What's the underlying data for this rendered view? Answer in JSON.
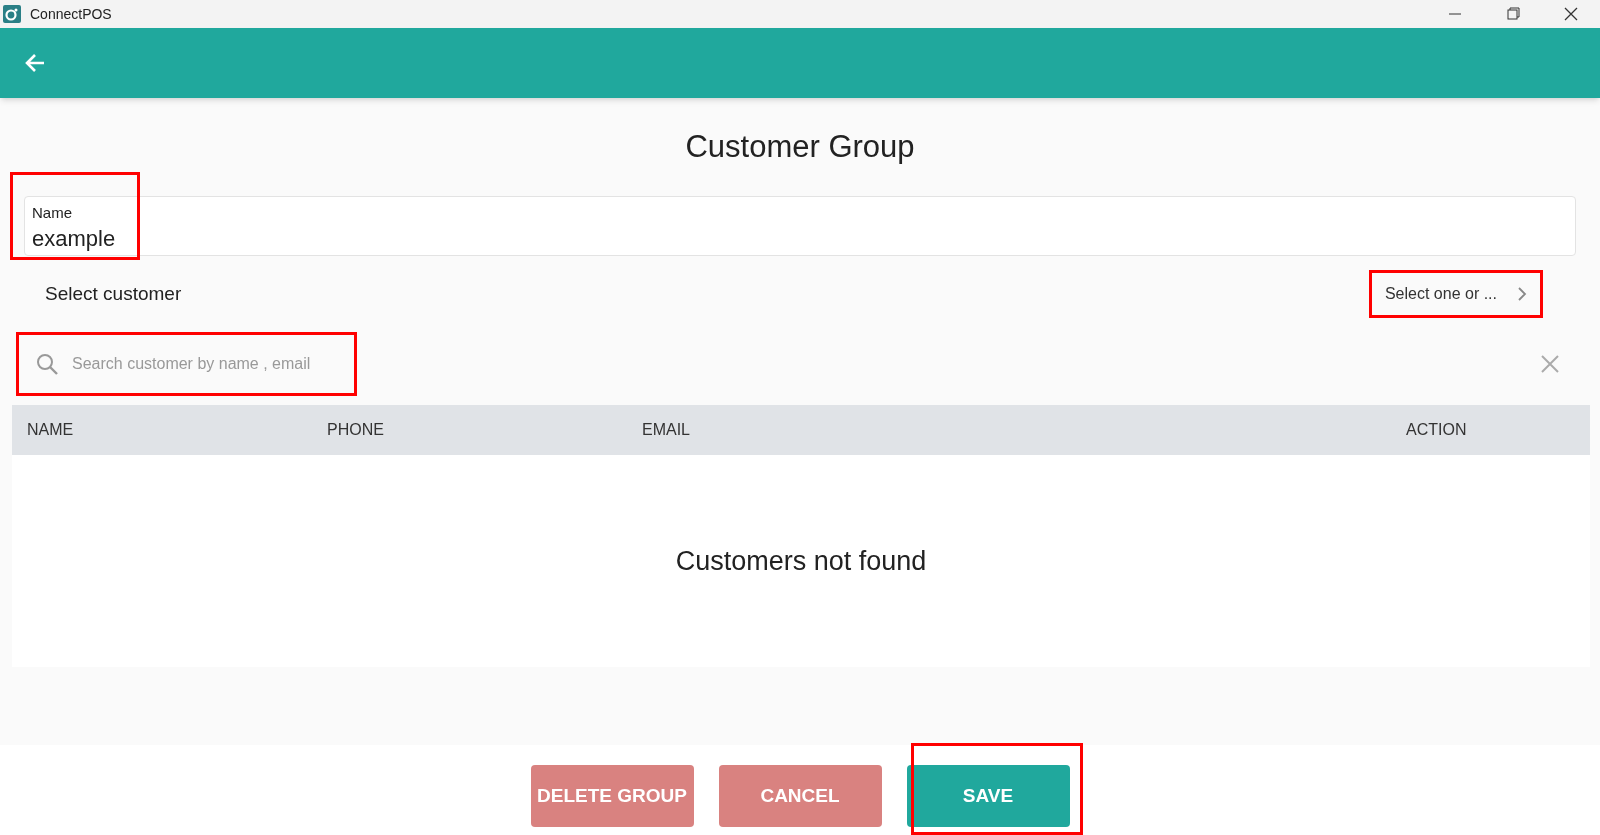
{
  "window": {
    "title": "ConnectPOS"
  },
  "page_title": "Customer Group",
  "name_field": {
    "label": "Name",
    "value": "example",
    "highlighted": true
  },
  "select_customer": {
    "label": "Select customer",
    "value": "Select one or ...",
    "highlighted": true
  },
  "search": {
    "placeholder": "Search customer by name , email",
    "highlighted": true
  },
  "table": {
    "columns": [
      "NAME",
      "PHONE",
      "EMAIL",
      "ACTION"
    ],
    "empty_message": "Customers not found"
  },
  "buttons": [
    {
      "label": "DELETE GROUP",
      "kind": "danger",
      "highlighted": false
    },
    {
      "label": "CANCEL",
      "kind": "danger",
      "highlighted": false
    },
    {
      "label": "SAVE",
      "kind": "primary",
      "highlighted": true
    }
  ]
}
